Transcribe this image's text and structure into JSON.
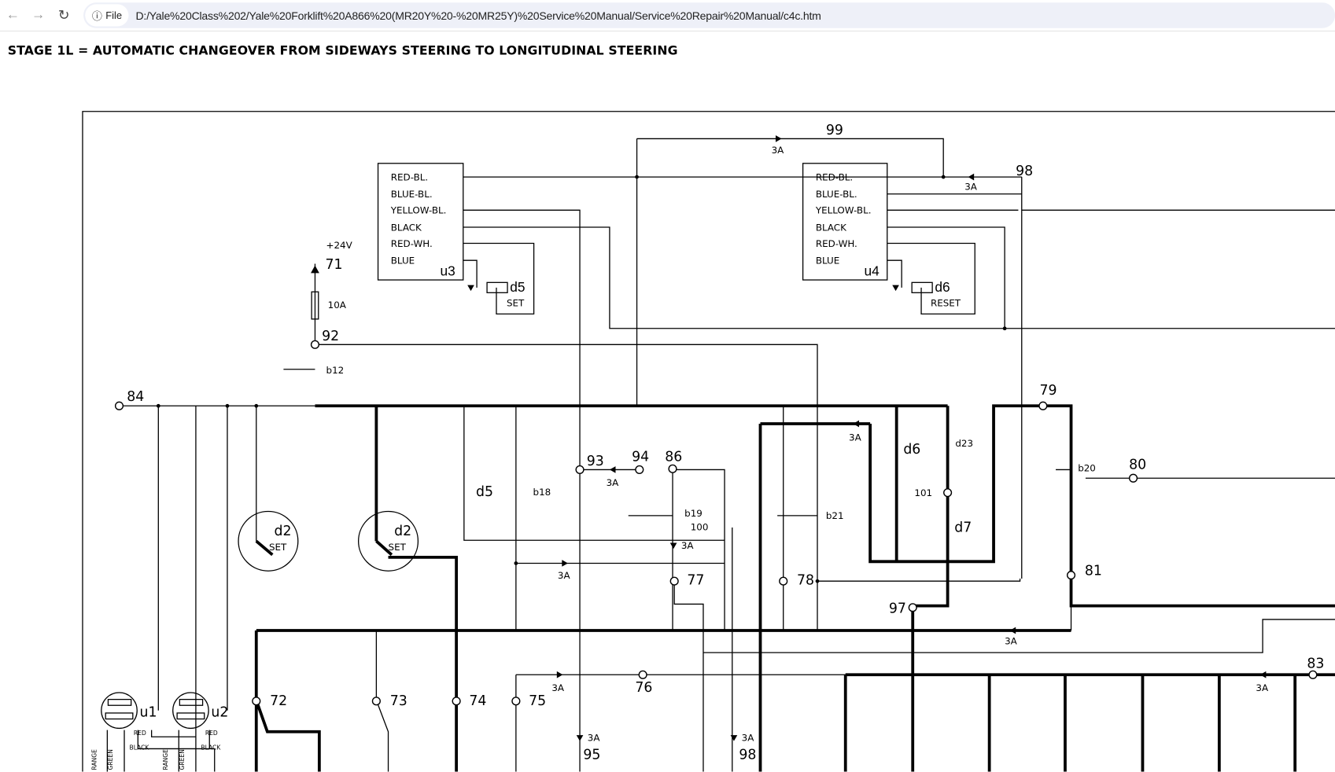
{
  "browser": {
    "back_icon": "arrow-left-icon",
    "forward_icon": "arrow-right-icon",
    "reload_icon": "reload-icon",
    "info_icon": "info-icon",
    "scheme_label": "File",
    "url": "D:/Yale%20Class%202/Yale%20Forklift%20A866%20(MR20Y%20-%20MR25Y)%20Service%20Manual/Service%20Repair%20Manual/c4c.htm"
  },
  "page": {
    "title": "STAGE 1L = AUTOMATIC CHANGEOVER FROM SIDEWAYS STEERING TO LONGITUDINAL STEERING"
  },
  "diagram": {
    "u3": {
      "wires": [
        "RED-BL.",
        "BLUE-BL.",
        "YELLOW-BL.",
        "BLACK",
        "RED-WH.",
        "BLUE"
      ],
      "name": "u3",
      "relay": "d5",
      "relay_label": "SET"
    },
    "u4": {
      "wires": [
        "RED-BL.",
        "BLUE-BL.",
        "YELLOW-BL.",
        "BLACK",
        "RED-WH.",
        "BLUE"
      ],
      "name": "u4",
      "relay": "d6",
      "relay_label": "RESET"
    },
    "labels": [
      "99",
      "3A",
      "98",
      "3A",
      "+24V",
      "71",
      "10A",
      "92",
      "b12",
      "84",
      "d2",
      "SET",
      "d2",
      "SET",
      "d5",
      "b18",
      "93",
      "94",
      "3A",
      "86",
      "b19",
      "100",
      "3A",
      "3A",
      "77",
      "78",
      "b21",
      "3A",
      "d6",
      "d23",
      "101",
      "d7",
      "79",
      "b20",
      "80",
      "81",
      "97",
      "3A",
      "83",
      "3A",
      "72",
      "73",
      "74",
      "75",
      "3A",
      "76",
      "3A",
      "95",
      "3A",
      "98",
      "u1",
      "u2",
      "RED",
      "BLACK",
      "RED",
      "BLACK",
      "RANGE",
      "GREEN",
      "RANGE",
      "GREEN"
    ]
  }
}
